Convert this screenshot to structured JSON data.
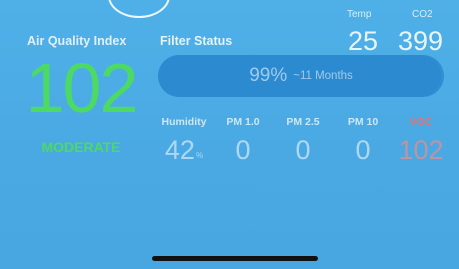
{
  "aqi": {
    "label": "Air Quality Index",
    "value": "102",
    "status": "MODERATE",
    "color": "#4cd964"
  },
  "filter": {
    "label": "Filter Status",
    "percent_text": "99%",
    "percent": 99,
    "remaining_text": "~11 Months"
  },
  "temp": {
    "label": "Temp",
    "value": "25"
  },
  "co2": {
    "label": "CO2",
    "value": "399"
  },
  "metrics": [
    {
      "label": "Humidity",
      "value": "42",
      "unit": "%"
    },
    {
      "label": "PM 1.0",
      "value": "0"
    },
    {
      "label": "PM 2.5",
      "value": "0"
    },
    {
      "label": "PM 10",
      "value": "0"
    },
    {
      "label": "VOC",
      "value": "102",
      "color": "#e57373"
    }
  ],
  "colors": {
    "background": "#4aa9e2",
    "bar": "#2f8fd0"
  }
}
